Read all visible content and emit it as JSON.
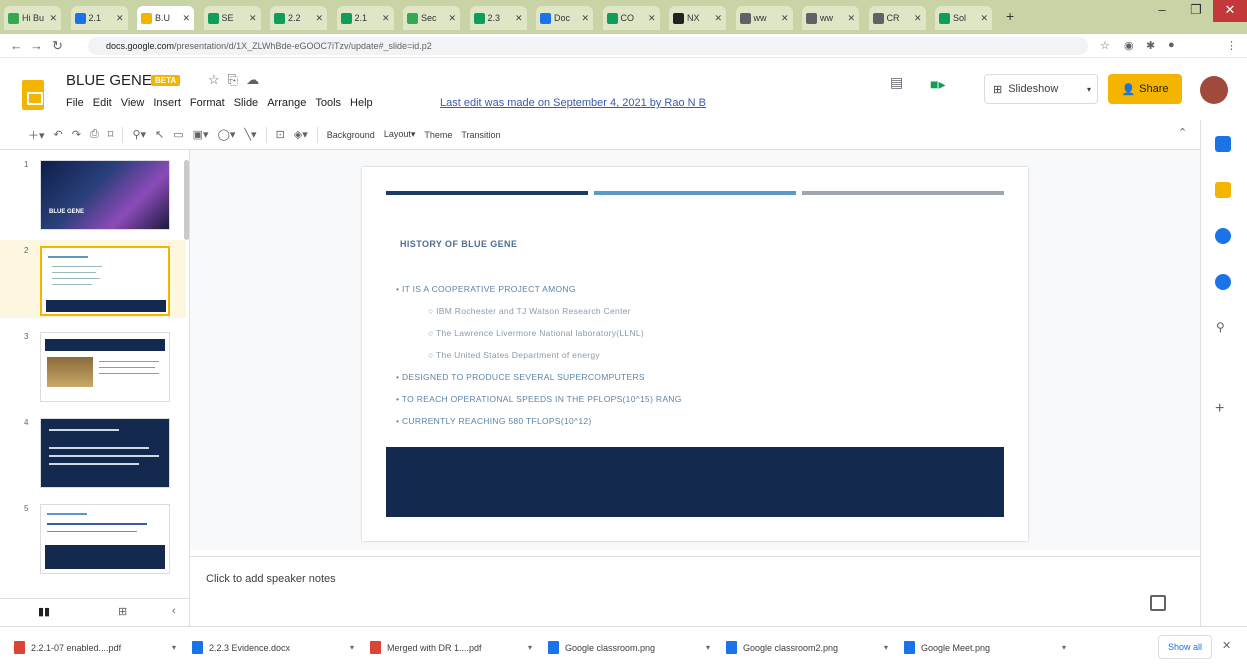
{
  "browser": {
    "tabs": [
      {
        "label": "Hi Bu",
        "color": "#34a853"
      },
      {
        "label": "2.1",
        "color": "#1a73e8"
      },
      {
        "label": "B.U",
        "color": "#f4b400",
        "active": true
      },
      {
        "label": "SE",
        "color": "#0f9d58"
      },
      {
        "label": "2.2",
        "color": "#0f9d58"
      },
      {
        "label": "2.1",
        "color": "#0f9d58"
      },
      {
        "label": "Sec",
        "color": "#34a853"
      },
      {
        "label": "2.3",
        "color": "#0f9d58"
      },
      {
        "label": "Doc",
        "color": "#1a73e8"
      },
      {
        "label": "CO",
        "color": "#0f9d58"
      },
      {
        "label": "NX",
        "color": "#222222"
      },
      {
        "label": "ww",
        "color": "#5f6368"
      },
      {
        "label": "ww",
        "color": "#5f6368"
      },
      {
        "label": "CR",
        "color": "#5f6368"
      },
      {
        "label": "Sol",
        "color": "#0f9d58"
      }
    ],
    "url_host": "docs.google.com",
    "url_path": "/presentation/d/1X_ZLWhBde-eGOOC7iTzv/update#_slide=id.p2"
  },
  "doc": {
    "title": "BLUE GENE",
    "badge": "BETA",
    "menus": [
      "File",
      "Edit",
      "View",
      "Insert",
      "Format",
      "Slide",
      "Arrange",
      "Tools",
      "Help"
    ],
    "last_edit": "Last edit was made on September 4, 2021 by Rao N B",
    "slideshow_label": "Slideshow",
    "share_label": "Share"
  },
  "toolbar": {
    "background": "Background",
    "layout": "Layout",
    "theme": "Theme",
    "transition": "Transition"
  },
  "filmstrip": {
    "numbers": [
      "1",
      "2",
      "3",
      "4",
      "5"
    ],
    "thumb1_title": "BLUE GENE"
  },
  "slide": {
    "bar_colors": [
      "#1d3c63",
      "#5b9ac7",
      "#9fa6ad"
    ],
    "heading": "HISTORY OF BLUE GENE",
    "bullets": [
      {
        "text": "IT IS A COOPERATIVE PROJECT AMONG",
        "level": 1
      },
      {
        "text": "IBM Rochester and TJ Watson Research Center",
        "level": 2
      },
      {
        "text": "The Lawrence Livermore National laboratory(LLNL)",
        "level": 2
      },
      {
        "text": "The United States Department of energy",
        "level": 2
      },
      {
        "text": "DESIGNED TO PRODUCE SEVERAL SUPERCOMPUTERS",
        "level": 1
      },
      {
        "text": "TO REACH OPERATIONAL SPEEDS IN THE PFLOPS(10^15) RANG",
        "level": 1
      },
      {
        "text": "CURRENTLY REACHING 580 TFLOPS(10^12)",
        "level": 1
      }
    ]
  },
  "notes": {
    "placeholder": "Click to add speaker notes"
  },
  "downloads": {
    "items": [
      {
        "label": "2.2.1-07 enabled....pdf",
        "color": "#db4437"
      },
      {
        "label": "2.2.3 Evidence.docx",
        "color": "#1a73e8"
      },
      {
        "label": "Merged with DR 1....pdf",
        "color": "#db4437"
      },
      {
        "label": "Google classroom.png",
        "color": "#1a73e8"
      },
      {
        "label": "Google classroom2.png",
        "color": "#1a73e8"
      },
      {
        "label": "Google Meet.png",
        "color": "#1a73e8"
      }
    ],
    "show_all": "Show all"
  }
}
